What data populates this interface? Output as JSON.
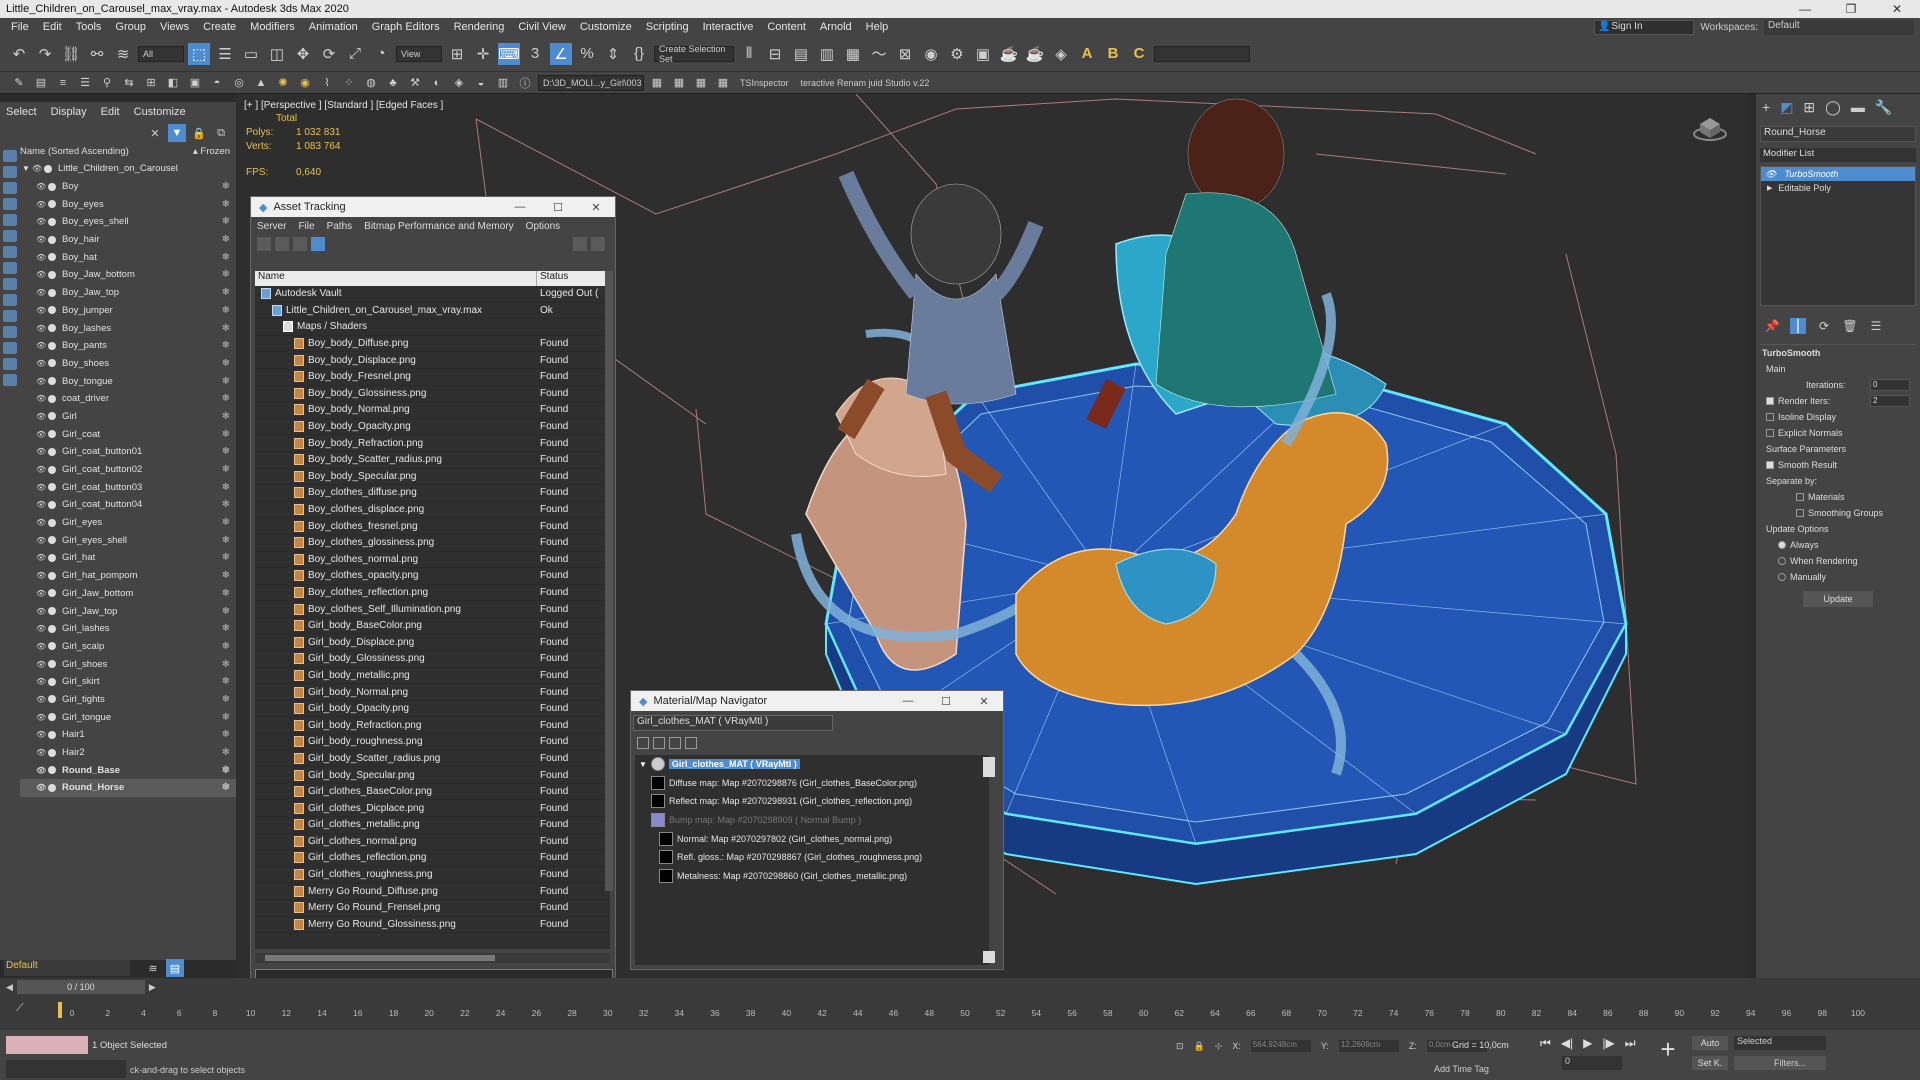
{
  "window": {
    "title": "Little_Children_on_Carousel_max_vray.max - Autodesk 3ds Max 2020",
    "controls": [
      "—",
      "❐",
      "✕"
    ]
  },
  "menubar": {
    "items": [
      "File",
      "Edit",
      "Tools",
      "Group",
      "Views",
      "Create",
      "Modifiers",
      "Animation",
      "Graph Editors",
      "Rendering",
      "Civil View",
      "Customize",
      "Scripting",
      "Interactive",
      "Content",
      "Arnold",
      "Help"
    ],
    "signin": "Sign In",
    "workspaces_label": "Workspaces:",
    "workspaces_value": "Default"
  },
  "toolbar": {
    "filter": "All",
    "refcoord": "View",
    "selection_set": "Create Selection Set",
    "path": "D:\\3D_MOLI...y_Girl\\003",
    "tsinspector": "TSInspector",
    "rename": "teractive Renam juid Studio v.22"
  },
  "scene_explorer": {
    "tabs": [
      "Select",
      "Display",
      "Edit",
      "Customize"
    ],
    "column_name": "Name (Sorted Ascending)",
    "column_frozen": "▴ Frozen",
    "root": "Little_Children_on_Carousel",
    "items": [
      "Boy",
      "Boy_eyes",
      "Boy_eyes_shell",
      "Boy_hair",
      "Boy_hat",
      "Boy_Jaw_bottom",
      "Boy_Jaw_top",
      "Boy_jumper",
      "Boy_lashes",
      "Boy_pants",
      "Boy_shoes",
      "Boy_tongue",
      "coat_driver",
      "Girl",
      "Girl_coat",
      "Girl_coat_button01",
      "Girl_coat_button02",
      "Girl_coat_button03",
      "Girl_coat_button04",
      "Girl_eyes",
      "Girl_eyes_shell",
      "Girl_hat",
      "Girl_hat_pompom",
      "Girl_Jaw_bottom",
      "Girl_Jaw_top",
      "Girl_lashes",
      "Girl_scalp",
      "Girl_shoes",
      "Girl_skirt",
      "Girl_tights",
      "Girl_tongue",
      "Hair1",
      "Hair2",
      "Round_Base",
      "Round_Horse"
    ],
    "layer": "Default"
  },
  "viewport": {
    "label": "[+ ] [Perspective ] [Standard ] [Edged Faces ]",
    "total_label": "Total",
    "polys_label": "Polys:",
    "polys_value": "1 032 831",
    "verts_label": "Verts:",
    "verts_value": "1 083 764",
    "fps_label": "FPS:",
    "fps_value": "0,640"
  },
  "asset_tracking": {
    "title": "Asset Tracking",
    "menu": [
      "Server",
      "File",
      "Paths",
      "Bitmap Performance and Memory",
      "Options"
    ],
    "col_name": "Name",
    "col_status": "Status",
    "rows": [
      {
        "name": "Autodesk Vault",
        "status": "Logged Out (",
        "indent": 0
      },
      {
        "name": "Little_Children_on_Carousel_max_vray.max",
        "status": "Ok",
        "indent": 1
      },
      {
        "name": "Maps / Shaders",
        "status": "",
        "indent": 2
      },
      {
        "name": "Boy_body_Diffuse.png",
        "status": "Found",
        "indent": 3
      },
      {
        "name": "Boy_body_Displace.png",
        "status": "Found",
        "indent": 3
      },
      {
        "name": "Boy_body_Fresnel.png",
        "status": "Found",
        "indent": 3
      },
      {
        "name": "Boy_body_Glossiness.png",
        "status": "Found",
        "indent": 3
      },
      {
        "name": "Boy_body_Normal.png",
        "status": "Found",
        "indent": 3
      },
      {
        "name": "Boy_body_Opacity.png",
        "status": "Found",
        "indent": 3
      },
      {
        "name": "Boy_body_Refraction.png",
        "status": "Found",
        "indent": 3
      },
      {
        "name": "Boy_body_Scatter_radius.png",
        "status": "Found",
        "indent": 3
      },
      {
        "name": "Boy_body_Specular.png",
        "status": "Found",
        "indent": 3
      },
      {
        "name": "Boy_clothes_diffuse.png",
        "status": "Found",
        "indent": 3
      },
      {
        "name": "Boy_clothes_displace.png",
        "status": "Found",
        "indent": 3
      },
      {
        "name": "Boy_clothes_fresnel.png",
        "status": "Found",
        "indent": 3
      },
      {
        "name": "Boy_clothes_glossiness.png",
        "status": "Found",
        "indent": 3
      },
      {
        "name": "Boy_clothes_normal.png",
        "status": "Found",
        "indent": 3
      },
      {
        "name": "Boy_clothes_opacity.png",
        "status": "Found",
        "indent": 3
      },
      {
        "name": "Boy_clothes_reflection.png",
        "status": "Found",
        "indent": 3
      },
      {
        "name": "Boy_clothes_Self_Illumination.png",
        "status": "Found",
        "indent": 3
      },
      {
        "name": "Girl_body_BaseColor.png",
        "status": "Found",
        "indent": 3
      },
      {
        "name": "Girl_body_Displace.png",
        "status": "Found",
        "indent": 3
      },
      {
        "name": "Girl_body_Glossiness.png",
        "status": "Found",
        "indent": 3
      },
      {
        "name": "Girl_body_metallic.png",
        "status": "Found",
        "indent": 3
      },
      {
        "name": "Girl_body_Normal.png",
        "status": "Found",
        "indent": 3
      },
      {
        "name": "Girl_body_Opacity.png",
        "status": "Found",
        "indent": 3
      },
      {
        "name": "Girl_body_Refraction.png",
        "status": "Found",
        "indent": 3
      },
      {
        "name": "Girl_body_roughness.png",
        "status": "Found",
        "indent": 3
      },
      {
        "name": "Girl_body_Scatter_radius.png",
        "status": "Found",
        "indent": 3
      },
      {
        "name": "Girl_body_Specular.png",
        "status": "Found",
        "indent": 3
      },
      {
        "name": "Girl_clothes_BaseColor.png",
        "status": "Found",
        "indent": 3
      },
      {
        "name": "Girl_clothes_Dicplace.png",
        "status": "Found",
        "indent": 3
      },
      {
        "name": "Girl_clothes_metallic.png",
        "status": "Found",
        "indent": 3
      },
      {
        "name": "Girl_clothes_normal.png",
        "status": "Found",
        "indent": 3
      },
      {
        "name": "Girl_clothes_reflection.png",
        "status": "Found",
        "indent": 3
      },
      {
        "name": "Girl_clothes_roughness.png",
        "status": "Found",
        "indent": 3
      },
      {
        "name": "Merry Go Round_Diffuse.png",
        "status": "Found",
        "indent": 3
      },
      {
        "name": "Merry Go Round_Frensel.png",
        "status": "Found",
        "indent": 3
      },
      {
        "name": "Merry Go Round_Glossiness.png",
        "status": "Found",
        "indent": 3
      }
    ]
  },
  "material_navigator": {
    "title": "Material/Map Navigator",
    "field": "Girl_clothes_MAT  ( VRayMtl )",
    "root": "Girl_clothes_MAT  ( VRayMtl )",
    "maps": [
      {
        "label": "Diffuse map: Map #2070298876 (Girl_clothes_BaseColor.png)",
        "dim": false
      },
      {
        "label": "Reflect map: Map #2070298931 (Girl_clothes_reflection.png)",
        "dim": false
      },
      {
        "label": "Bump map: Map #2070298909  ( Normal Bump )",
        "dim": true
      },
      {
        "label": "Normal: Map #2070297802 (Girl_clothes_normal.png)",
        "dim": false
      },
      {
        "label": "Refl. gloss.: Map #2070298867 (Girl_clothes_roughness.png)",
        "dim": false
      },
      {
        "label": "Metalness: Map #2070298860 (Girl_clothes_metallic.png)",
        "dim": false
      }
    ]
  },
  "command_panel": {
    "object_name": "Round_Horse",
    "modifier_list": "Modifier List",
    "stack": [
      "TurboSmooth",
      "Editable Poly"
    ],
    "rollout_title": "TurboSmooth",
    "main_label": "Main",
    "iterations_label": "Iterations:",
    "iterations_value": "0",
    "render_iters_label": "Render Iters:",
    "render_iters_value": "2",
    "isoline_label": "Isoline Display",
    "explicit_normals_label": "Explicit Normals",
    "surface_params_label": "Surface Parameters",
    "smooth_result_label": "Smooth Result",
    "separate_by_label": "Separate by:",
    "materials_label": "Materials",
    "smoothing_groups_label": "Smoothing Groups",
    "update_options_label": "Update Options",
    "always_label": "Always",
    "when_rendering_label": "When Rendering",
    "manually_label": "Manually",
    "update_button": "Update"
  },
  "timeline": {
    "slider": "0 / 100",
    "ticks": [
      "0",
      "2",
      "4",
      "6",
      "8",
      "10",
      "12",
      "14",
      "16",
      "18",
      "20",
      "22",
      "24",
      "26",
      "28",
      "30",
      "32",
      "34",
      "36",
      "38",
      "40",
      "42",
      "44",
      "46",
      "48",
      "50",
      "52",
      "54",
      "56",
      "58",
      "60",
      "62",
      "64",
      "66",
      "68",
      "70",
      "72",
      "74",
      "76",
      "78",
      "80",
      "82",
      "84",
      "86",
      "88",
      "90",
      "92",
      "94",
      "96",
      "98",
      "100"
    ]
  },
  "status": {
    "selection": "1 Object Selected",
    "hint": "ck-and-drag to select objects",
    "x_label": "X:",
    "x_value": "564,9248cm",
    "y_label": "Y:",
    "y_value": "12,2609cm",
    "z_label": "Z:",
    "z_value": "0,0cm",
    "grid": "Grid = 10,0cm",
    "add_time_tag": "Add Time Tag",
    "auto": "Auto",
    "setk": "Set K.",
    "selected": "Selected",
    "filters": "Filters...",
    "frame": "0"
  },
  "colors": {
    "accent": "#4d8ccf",
    "stats": "#e7c14a",
    "platform_blue": "#1f4fa8",
    "horse_orange": "#d48a2a",
    "outline_cyan": "#5fe8ff"
  }
}
